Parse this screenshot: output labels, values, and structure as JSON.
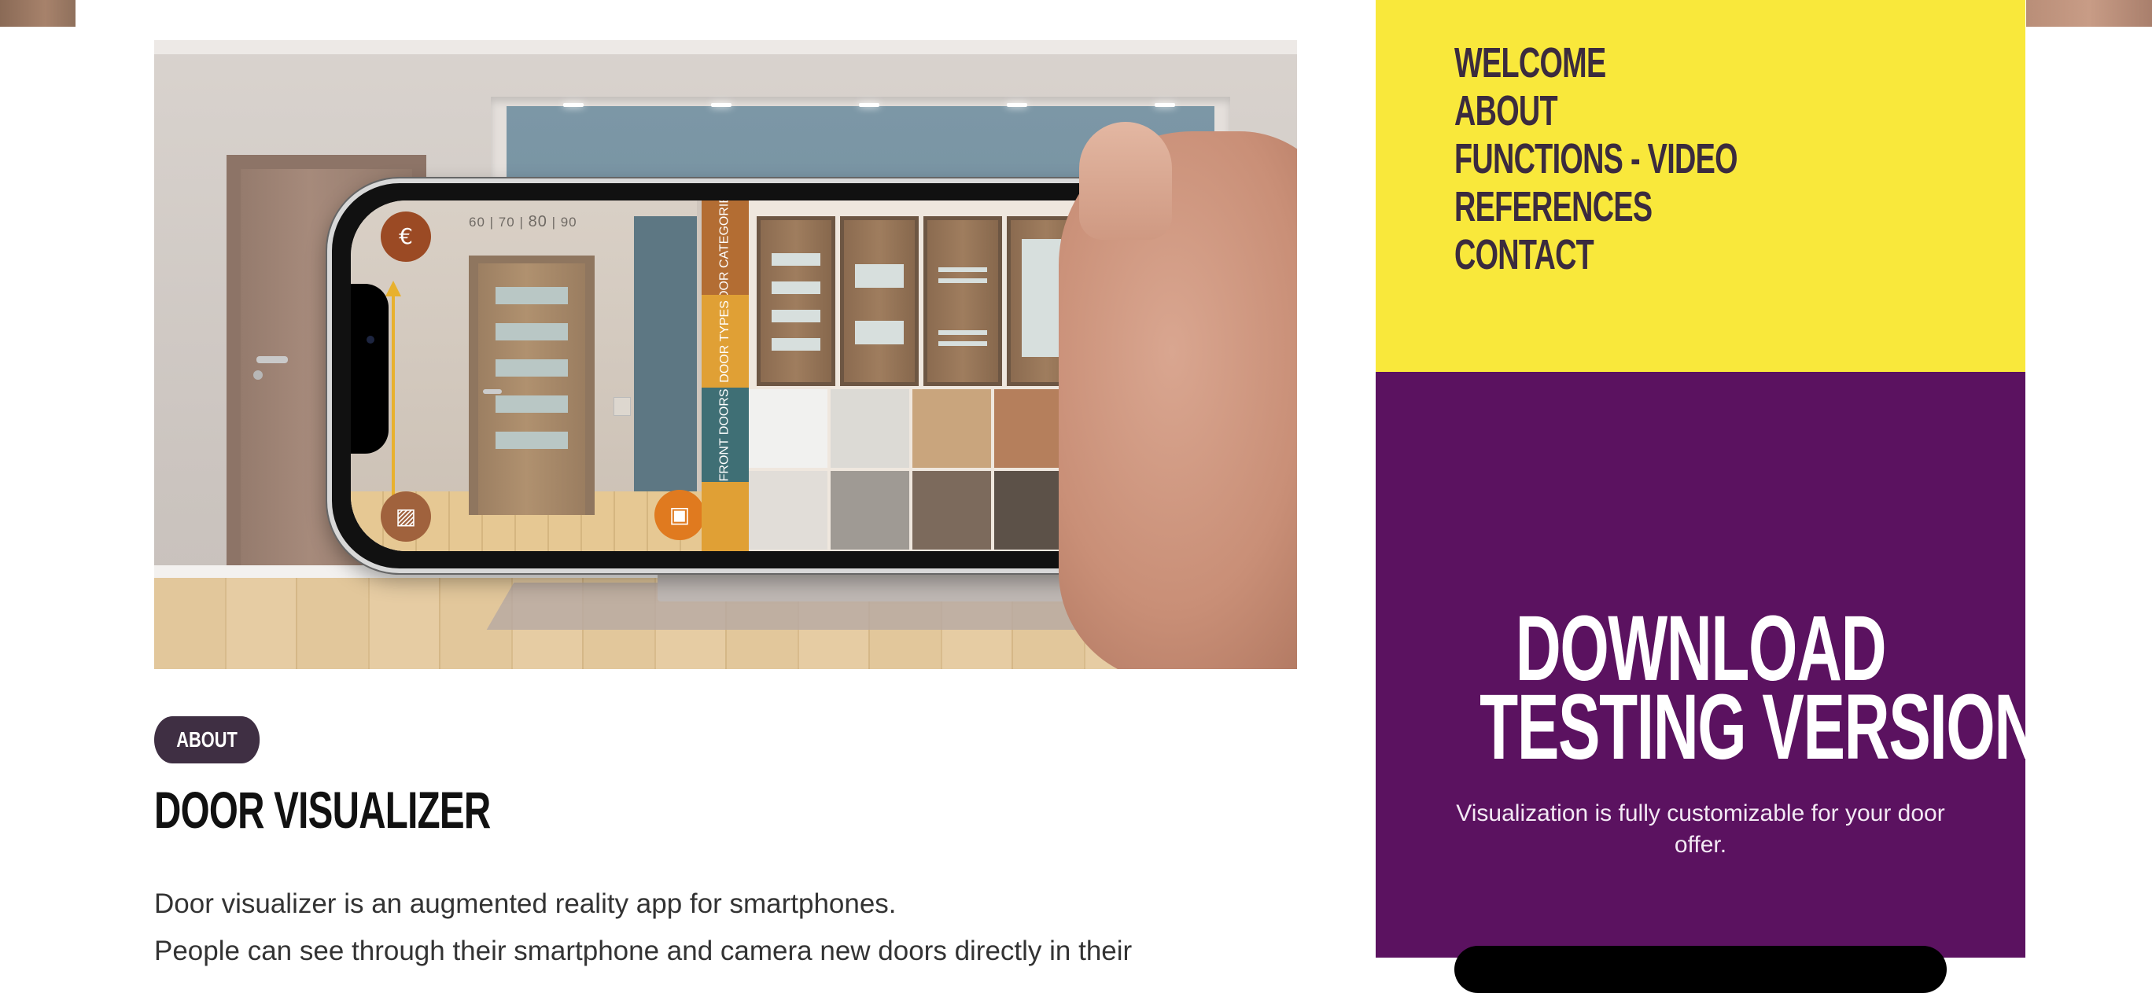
{
  "hero": {
    "scale_labels": [
      "60",
      "70",
      "80",
      "90"
    ],
    "tabs": [
      "DOOR CATEGORIES",
      "DOOR TYPES",
      "FRONT DOORS"
    ],
    "icons": [
      "price-list-icon",
      "pattern-icon",
      "gallery-icon",
      "camera-icon",
      "add-document-icon"
    ],
    "colors": {
      "orange": "#e07a1f",
      "red": "#b51f24",
      "amber": "#ee9a2a",
      "brown": "#9b4a24",
      "tab_teal": "#3f6f75"
    }
  },
  "article": {
    "badge": "ABOUT",
    "title": "DOOR VISUALIZER",
    "paragraphs": [
      "Door visualizer is an augmented reality app for smartphones.",
      "People can see through their smartphone and camera new doors directly in their"
    ]
  },
  "nav": {
    "items": [
      "WELCOME",
      "ABOUT",
      "FUNCTIONS - VIDEO",
      "REFERENCES",
      "CONTACT"
    ]
  },
  "download": {
    "title_line1": "DOWNLOAD",
    "title_line2": "TESTING VERSION",
    "text": "Visualization is fully customizable for your door offer.",
    "button_label": ""
  },
  "colors": {
    "nav_background": "#f9e83b",
    "cta_background": "#5b1260",
    "text_dark": "#3b2b3e"
  }
}
